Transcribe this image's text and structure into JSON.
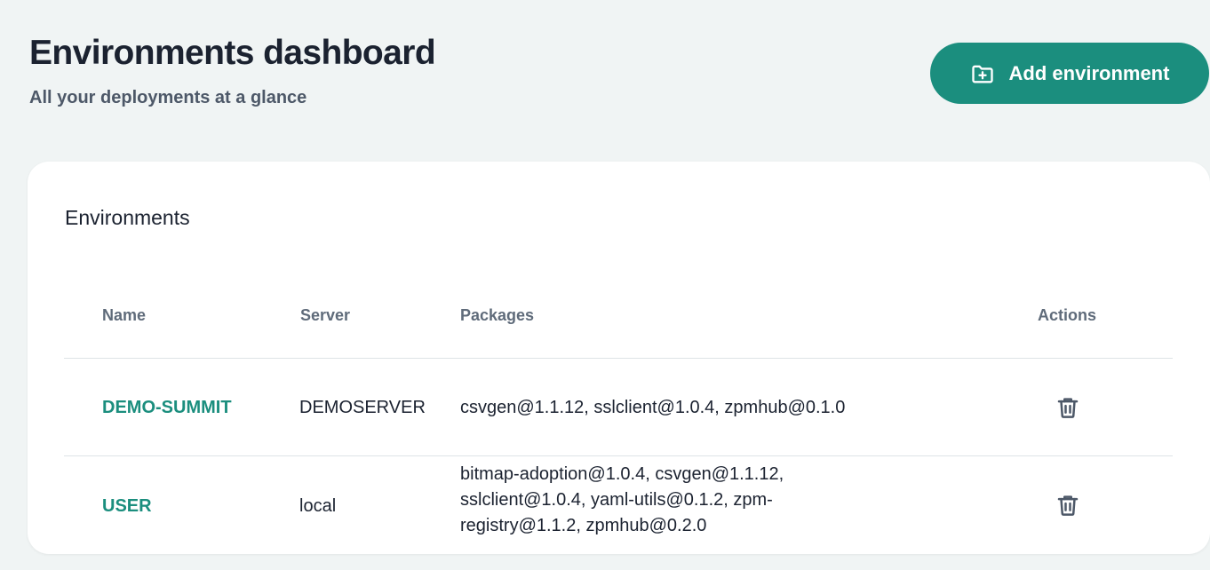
{
  "header": {
    "title": "Environments dashboard",
    "subtitle": "All your deployments at a glance",
    "add_button_label": "Add environment",
    "add_button_icon": "folder-plus-icon"
  },
  "card": {
    "title": "Environments",
    "columns": {
      "name": "Name",
      "server": "Server",
      "packages": "Packages",
      "actions": "Actions"
    },
    "rows": [
      {
        "name": "DEMO-SUMMIT",
        "server": "DEMOSERVER",
        "packages": "csvgen@1.1.12, sslclient@1.0.4, zpmhub@0.1.0",
        "action_icon": "trash-icon"
      },
      {
        "name": "USER",
        "server": "local",
        "packages": "bitmap-adoption@1.0.4, csvgen@1.1.12, sslclient@1.0.4, yaml-utils@0.1.2, zpm-registry@1.1.2, zpmhub@0.2.0",
        "action_icon": "trash-icon"
      }
    ]
  },
  "colors": {
    "accent": "#1b8e7e",
    "background": "#f0f4f4",
    "card": "#ffffff",
    "text": "#1b2230",
    "muted": "#5f6b7a"
  }
}
